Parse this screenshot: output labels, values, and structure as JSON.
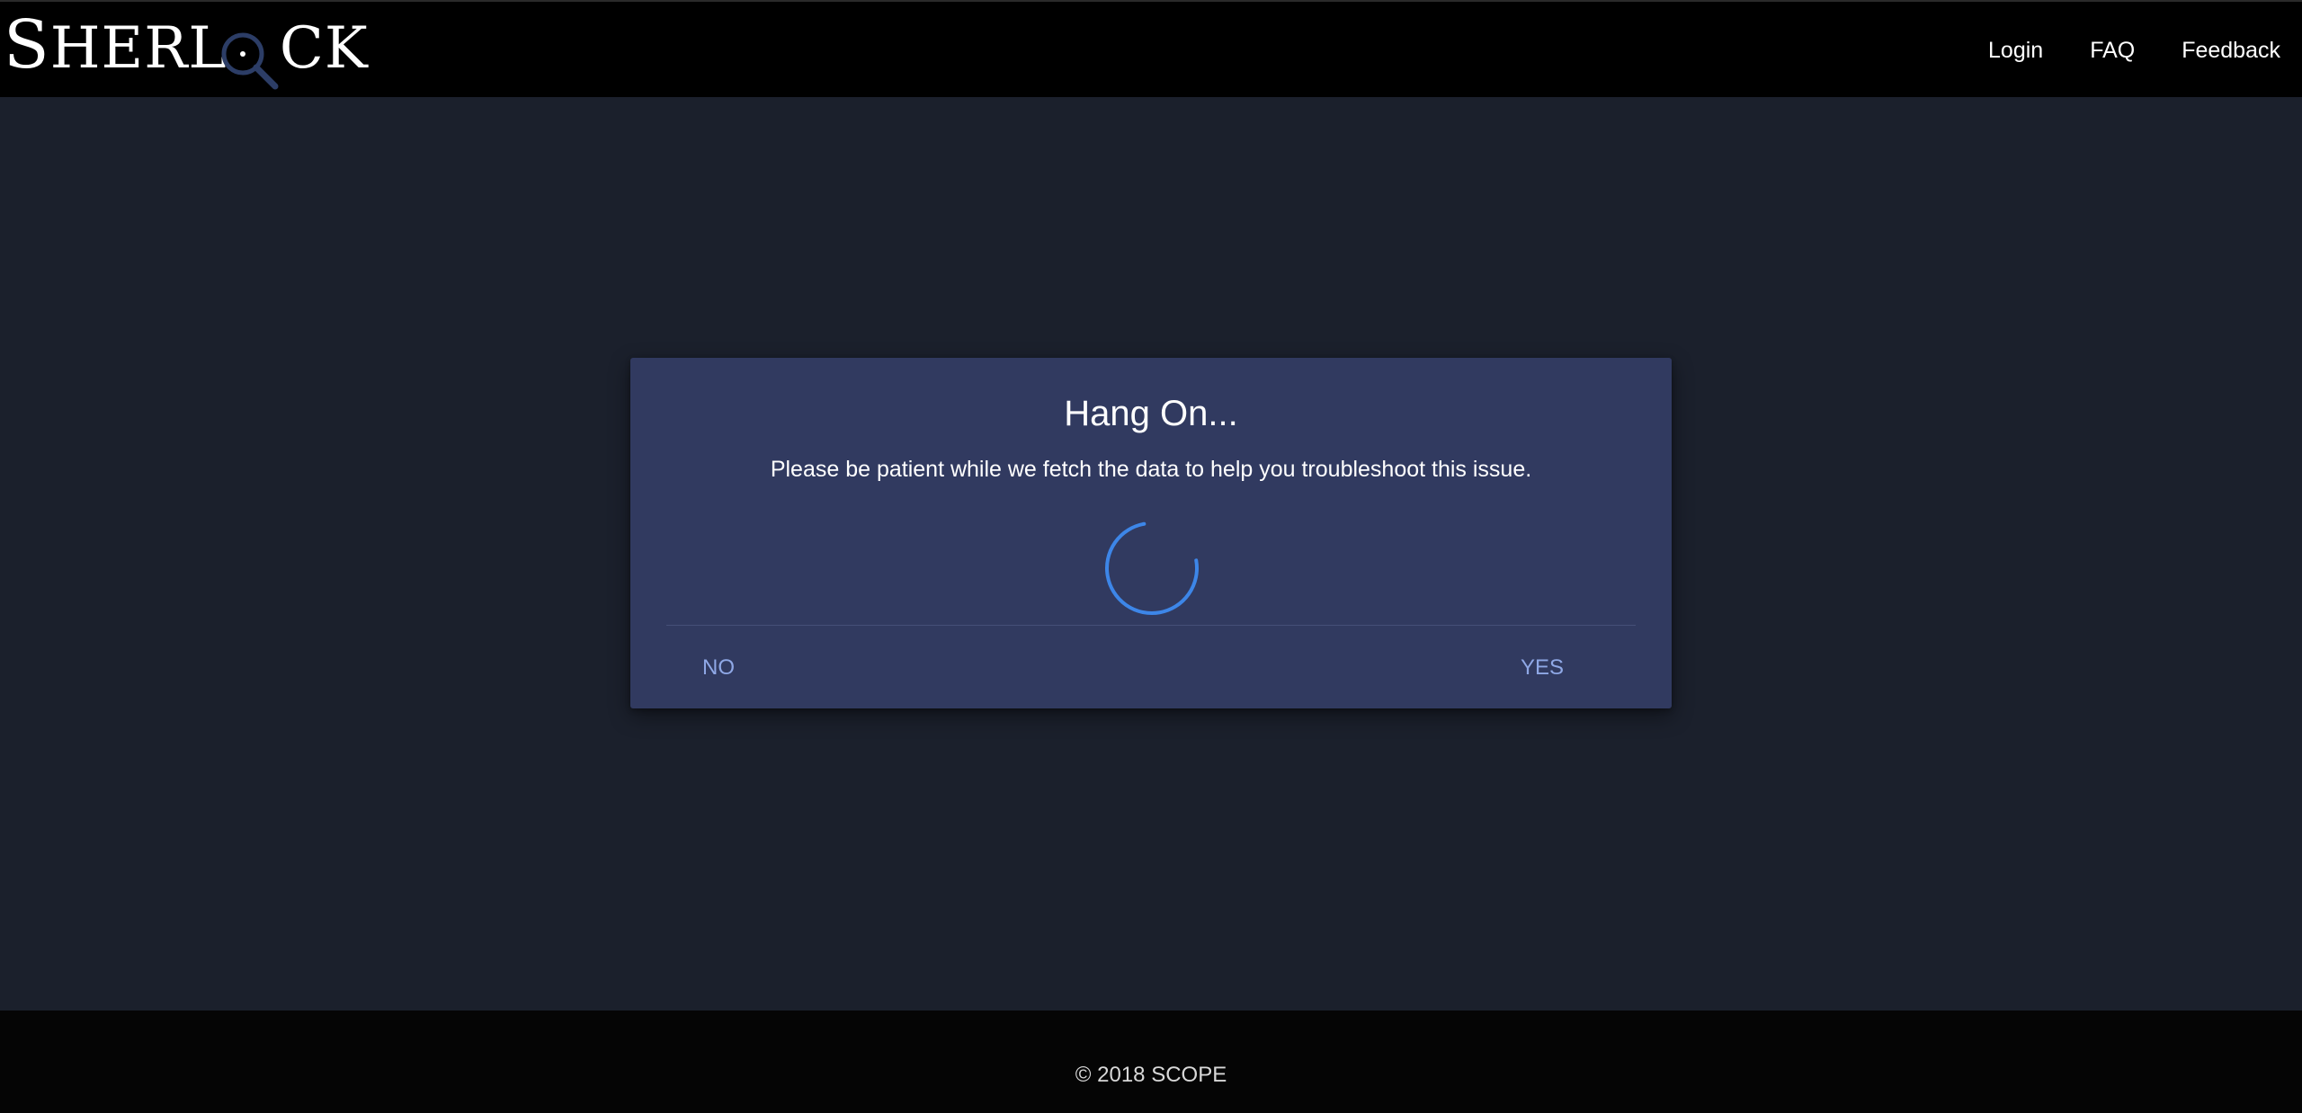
{
  "header": {
    "logo_text": "SHERLOCK",
    "nav": [
      {
        "label": "Login"
      },
      {
        "label": "FAQ"
      },
      {
        "label": "Feedback"
      }
    ]
  },
  "dialog": {
    "title": "Hang On...",
    "message": "Please be patient while we fetch the data to help you troubleshoot this issue.",
    "no_label": "NO",
    "yes_label": "YES",
    "spinner_icon": "loading-spinner-icon"
  },
  "footer": {
    "text": "© 2018 SCOPE"
  },
  "colors": {
    "page_background": "#1b202c",
    "header_background": "#000000",
    "dialog_background": "#313a60",
    "button_text": "#8fa8e6",
    "spinner": "#3d86e8",
    "logo_glass": "#2c3d66"
  }
}
